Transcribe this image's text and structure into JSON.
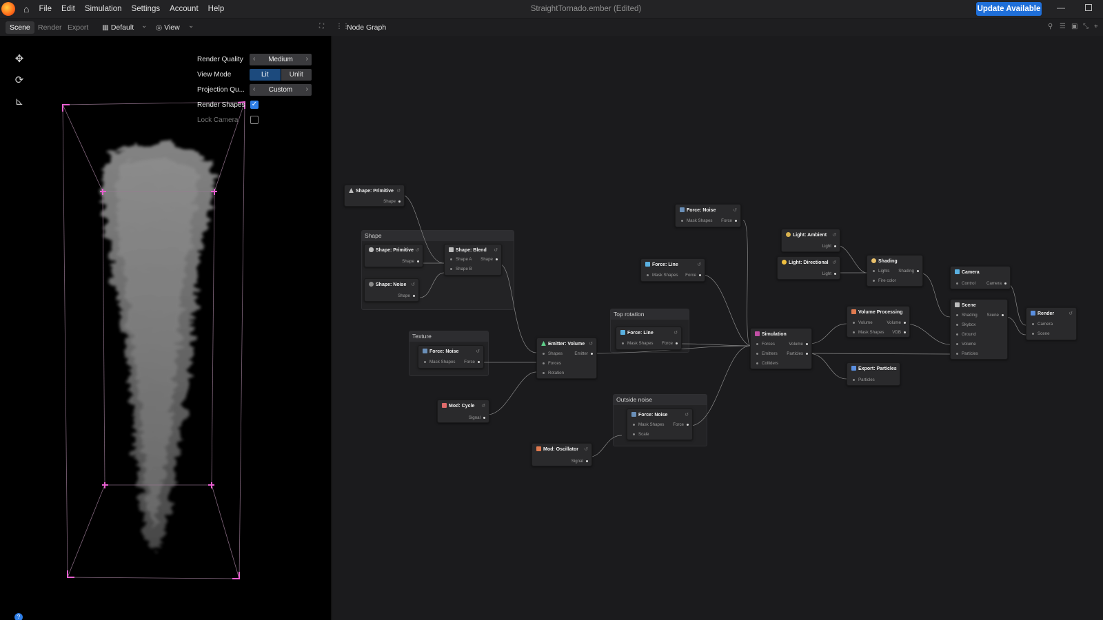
{
  "menubar": {
    "items": [
      "File",
      "Edit",
      "Simulation",
      "Settings",
      "Account",
      "Help"
    ],
    "title": "StraightTornado.ember",
    "title_suffix": "(Edited)",
    "update_label": "Update Available"
  },
  "toolbar": {
    "tabs": [
      "Scene",
      "Render",
      "Export"
    ],
    "layout_label": "Default",
    "view_label": "View",
    "graph_title": "Node Graph"
  },
  "viewport": {
    "settings": {
      "render_quality": {
        "label": "Render Quality",
        "value": "Medium"
      },
      "view_mode": {
        "label": "View Mode",
        "options": [
          "Lit",
          "Unlit"
        ],
        "selected": "Lit"
      },
      "projection": {
        "label": "Projection Qu...",
        "value": "Custom"
      },
      "render_shapes": {
        "label": "Render Shapes",
        "checked": true
      },
      "lock_camera": {
        "label": "Lock Camera",
        "checked": false
      }
    }
  },
  "graph": {
    "groups": {
      "shape": "Shape",
      "texture": "Texture",
      "top_rotation": "Top rotation",
      "outside_noise": "Outside noise"
    },
    "nodes": {
      "shape_primitive_a": {
        "title": "Shape: Primitive",
        "out": "Shape"
      },
      "shape_primitive_b": {
        "title": "Shape: Primitive",
        "out": "Shape"
      },
      "shape_noise": {
        "title": "Shape: Noise",
        "out": "Shape"
      },
      "shape_blend": {
        "title": "Shape: Blend",
        "in1": "Shape A",
        "in2": "Shape B",
        "out": "Shape"
      },
      "force_noise_tex": {
        "title": "Force: Noise",
        "in1": "Mask Shapes",
        "out": "Force"
      },
      "mod_cycle": {
        "title": "Mod: Cycle",
        "out": "Signal"
      },
      "emitter_volume": {
        "title": "Emitter: Volume",
        "in1": "Shapes",
        "in2": "Forces",
        "in3": "Rotation",
        "out": "Emitter"
      },
      "mod_oscillator": {
        "title": "Mod: Oscillator",
        "out": "Signal"
      },
      "force_noise_top": {
        "title": "Force: Noise",
        "in1": "Mask Shapes",
        "out": "Force"
      },
      "force_line_a": {
        "title": "Force: Line",
        "in1": "Mask Shapes",
        "out": "Force"
      },
      "force_line_b": {
        "title": "Force: Line",
        "in1": "Mask Shapes",
        "out": "Force"
      },
      "force_noise_out": {
        "title": "Force: Noise",
        "in1": "Mask Shapes",
        "in2": "Scale",
        "out": "Force"
      },
      "simulation": {
        "title": "Simulation",
        "in1": "Forces",
        "in2": "Emitters",
        "in3": "Colliders",
        "out1": "Volume",
        "out2": "Particles"
      },
      "light_ambient": {
        "title": "Light: Ambient",
        "out": "Light"
      },
      "light_directional": {
        "title": "Light: Directional",
        "out": "Light"
      },
      "shading": {
        "title": "Shading",
        "in1": "Lights",
        "in2": "Fire color",
        "out": "Shading"
      },
      "volume_processing": {
        "title": "Volume Processing",
        "in1": "Volume",
        "in2": "Mask Shapes",
        "out1": "Volume",
        "out2": "VDB"
      },
      "export_particles": {
        "title": "Export: Particles",
        "in1": "Particles"
      },
      "camera": {
        "title": "Camera",
        "in1": "Control",
        "out": "Camera"
      },
      "scene": {
        "title": "Scene",
        "in1": "Shading",
        "in2": "Skybox",
        "in3": "Ground",
        "in4": "Volume",
        "in5": "Particles",
        "out": "Scene"
      },
      "render": {
        "title": "Render",
        "in1": "Camera",
        "in2": "Scene"
      }
    }
  },
  "icons": {
    "logo": "ember-logo-icon",
    "home": "home-icon",
    "move": "move-icon",
    "rotate": "rotate-icon",
    "axes": "axes-icon"
  },
  "colors": {
    "accent": "#1f6fd9",
    "bounds": "#e85fd0",
    "background": "#1b1b1d"
  }
}
